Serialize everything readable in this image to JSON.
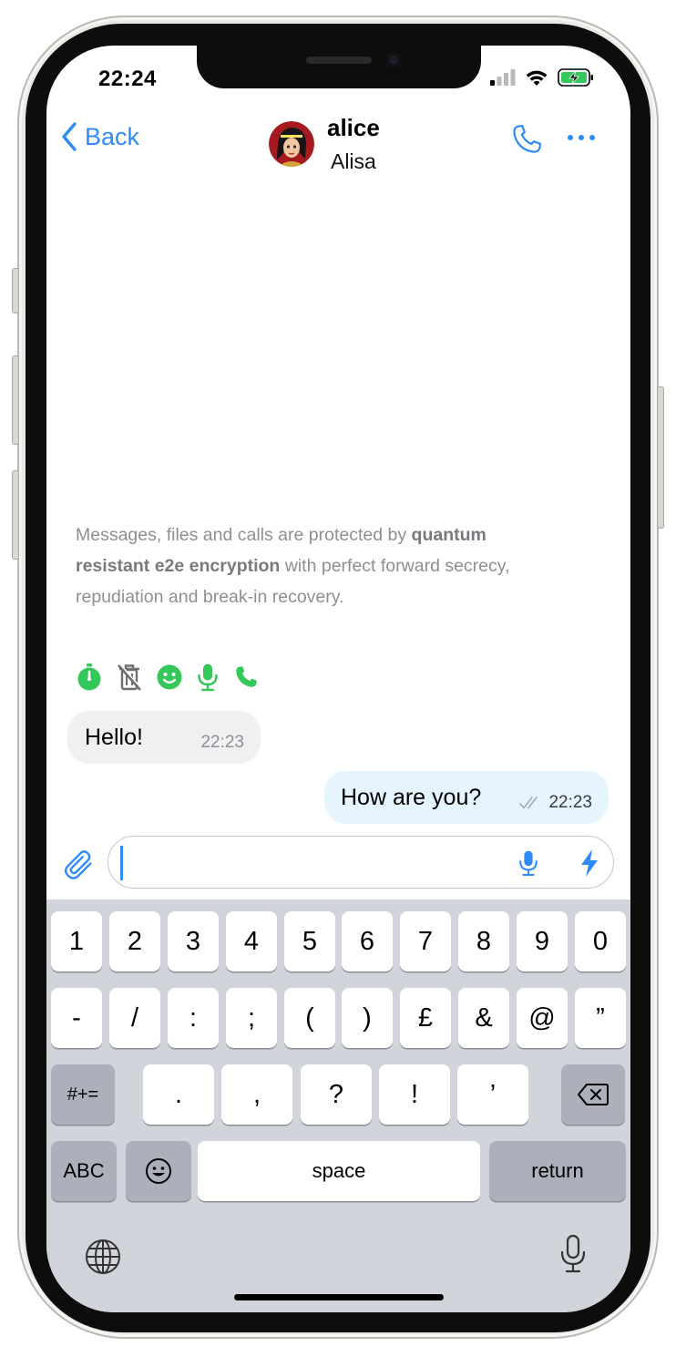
{
  "status_bar": {
    "time": "22:24"
  },
  "nav": {
    "back_label": "Back",
    "contact_name": "alice",
    "contact_display_name": "Alisa"
  },
  "chat": {
    "e2e_notice": {
      "prefix": "Messages, files and calls are protected by ",
      "bold": "quantum resistant e2e encryption",
      "suffix": " with perfect forward secrecy, repudiation and break-in recovery."
    },
    "feature_icons": [
      "timer-icon",
      "delete-disabled-icon",
      "smile-icon",
      "mic-icon",
      "phone-icon"
    ],
    "messages": [
      {
        "direction": "received",
        "text": "Hello!",
        "time": "22:23"
      },
      {
        "direction": "sent",
        "text": "How are you?",
        "time": "22:23",
        "status": "delivered"
      }
    ]
  },
  "composer": {
    "value": "",
    "placeholder": ""
  },
  "keyboard": {
    "row1": [
      "1",
      "2",
      "3",
      "4",
      "5",
      "6",
      "7",
      "8",
      "9",
      "0"
    ],
    "row2": [
      "-",
      "/",
      ":",
      ";",
      "(",
      ")",
      "£",
      "&",
      "@",
      "”"
    ],
    "row3_mode": "#+=",
    "row3": [
      ".",
      ",",
      "?",
      "!",
      "’"
    ],
    "abc_label": "ABC",
    "space_label": "space",
    "return_label": "return"
  },
  "colors": {
    "accent": "#2f8cf6",
    "feature_green": "#34c759",
    "received_bubble": "#f0f0f2",
    "sent_bubble": "#e6f4fe",
    "keyboard_bg": "#d1d4db"
  }
}
